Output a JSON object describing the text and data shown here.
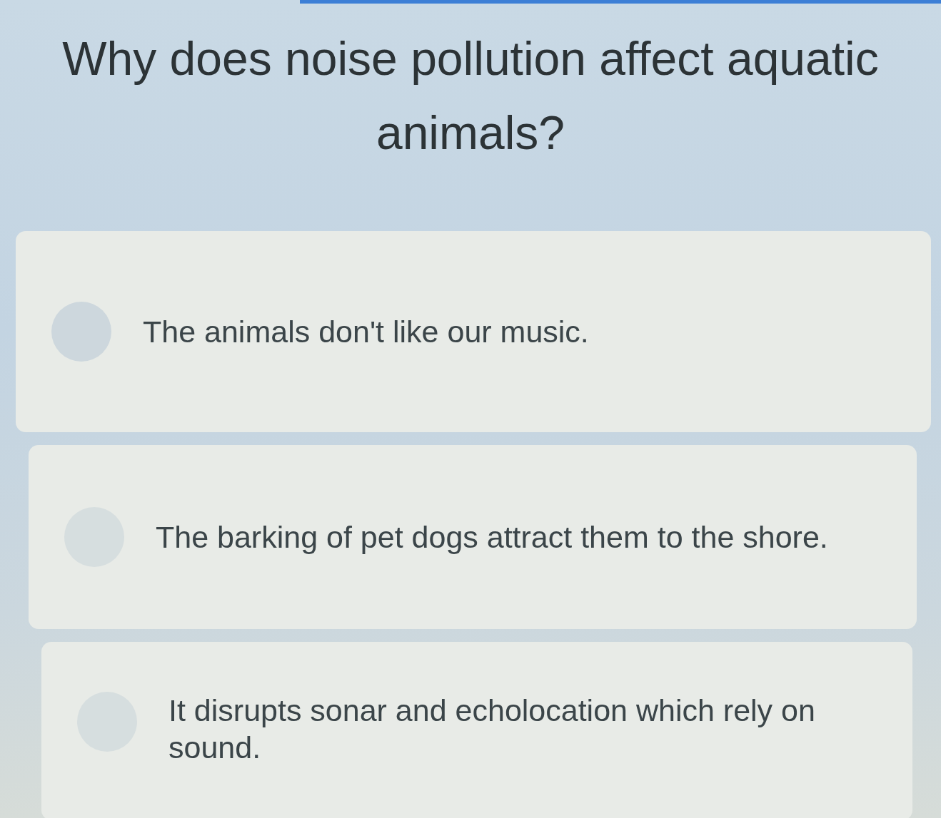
{
  "question": "Why does noise pollution affect aquatic animals?",
  "options": [
    {
      "text": "The animals don't like our music.",
      "selected": false
    },
    {
      "text": "The barking of pet dogs attract them to the shore.",
      "selected": false
    },
    {
      "text": "It disrupts sonar and echolocation which rely on sound.",
      "selected": false
    }
  ]
}
